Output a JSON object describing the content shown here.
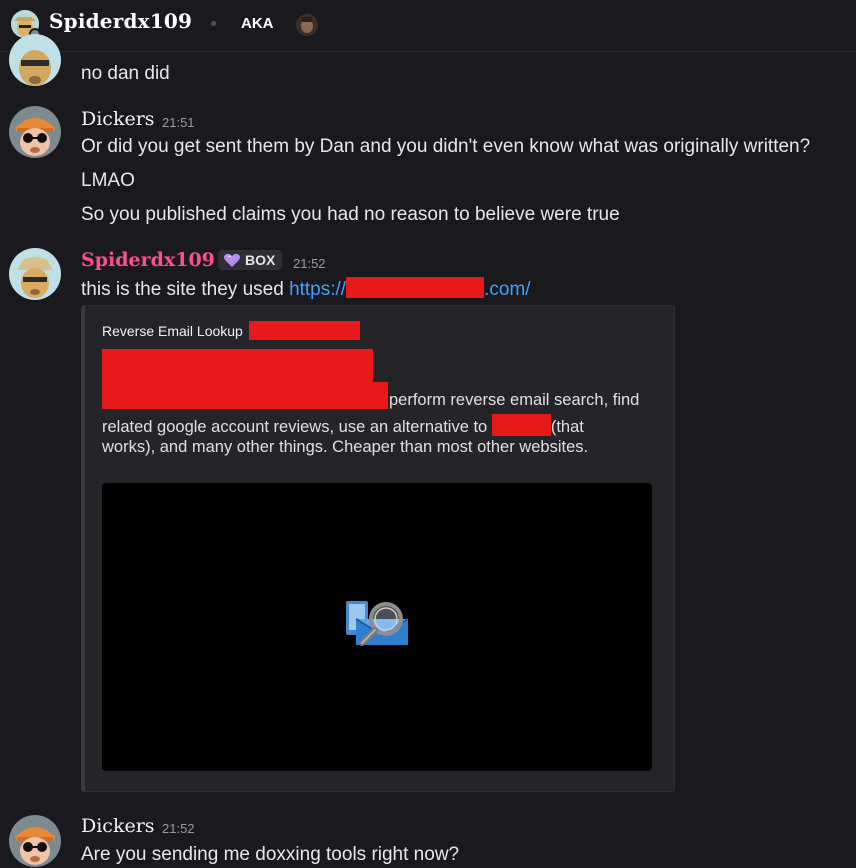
{
  "header": {
    "title": "Spiderdx109",
    "aka_label": "AKA"
  },
  "messages": [
    {
      "continuation_text": "no dan did"
    },
    {
      "author": "Dickers",
      "timestamp": "21:51",
      "lines": [
        "Or did you get sent them by Dan and you didn't even know what was originally written?",
        "LMAO",
        "So you published claims you had no reason to believe were true"
      ]
    },
    {
      "author": "Spiderdx109",
      "author_color": "#ff4f8f",
      "role_badge": "BOX",
      "timestamp": "21:52",
      "text_prefix": "this is the site they used ",
      "link_start": "https://",
      "link_end": ".com/"
    },
    {
      "author": "Dickers",
      "timestamp": "21:52",
      "lines": [
        "Are you sending me doxxing tools right now?"
      ]
    }
  ],
  "embed": {
    "title": "Reverse Email Lookup",
    "desc_line_3_tail": "perform reverse email search, find",
    "desc_line_4": "related google account reviews, use an alternative to ",
    "desc_line_4_tail": "(that",
    "desc_line_5": "works), and many other things. Cheaper than most other websites.",
    "image_icon": "envelope-magnifier-icon"
  },
  "colors": {
    "background": "#1a1a1e",
    "link": "#3ea1ff",
    "redaction": "#e8191a",
    "role_highlight": "#ff4f8f"
  }
}
